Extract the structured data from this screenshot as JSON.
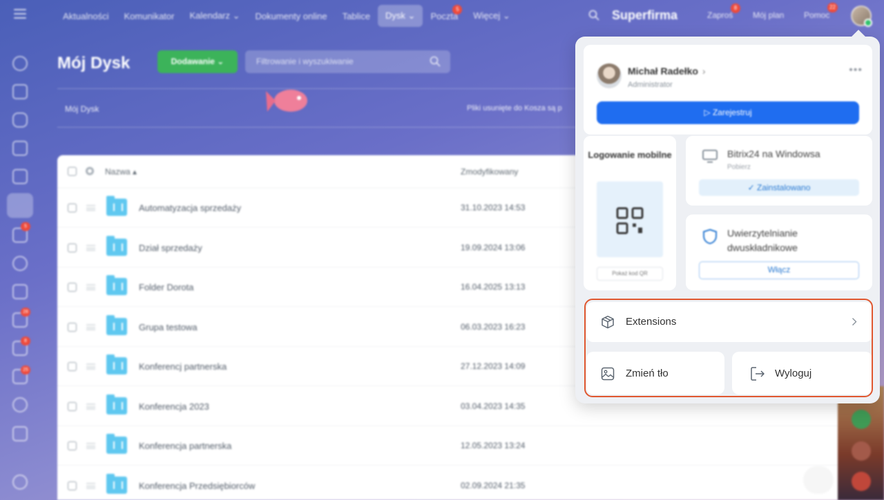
{
  "topbar": {
    "nav": [
      {
        "label": "Aktualności"
      },
      {
        "label": "Komunikator"
      },
      {
        "label": "Kalendarz ⌄"
      },
      {
        "label": "Dokumenty online"
      },
      {
        "label": "Tablice"
      },
      {
        "label": "Dysk ⌄"
      },
      {
        "label": "Poczta",
        "badge": "5"
      },
      {
        "label": "Więcej ⌄"
      }
    ],
    "brand": "Superfirma",
    "invite": "Zaproś",
    "invite_badge": "8",
    "my_plan": "Mój plan",
    "help": "Pomoc",
    "help_badge": "22"
  },
  "sidebar": {
    "badges": [
      "5",
      "28",
      "8",
      "25"
    ]
  },
  "page": {
    "title": "Mój Dysk",
    "add_button": "Dodawanie ⌄",
    "filter_placeholder": "Filtrowanie i wyszukiwanie",
    "breadcrumb": "Mój Dysk",
    "trash_info": "Pliki usunięte do Kosza są p"
  },
  "table": {
    "col_name": "Nazwa ▴",
    "col_modified": "Zmodyfikowany",
    "rows": [
      {
        "name": "Automatyzacja sprzedaży",
        "date": "31.10.2023 14:53"
      },
      {
        "name": "Dział sprzedaży",
        "date": "19.09.2024 13:06"
      },
      {
        "name": "Folder Dorota",
        "date": "16.04.2025 13:13"
      },
      {
        "name": "Grupa testowa",
        "date": "06.03.2023 16:23"
      },
      {
        "name": "Konferencj partnerska",
        "date": "27.12.2023 14:09"
      },
      {
        "name": "Konferencja 2023",
        "date": "03.04.2023 14:35"
      },
      {
        "name": "Konferencja partnerska",
        "date": "12.05.2023 13:24"
      },
      {
        "name": "Konferencja Przedsiębiorców",
        "date": "02.09.2024 21:35"
      }
    ]
  },
  "popup": {
    "user_name": "Michał Radełko",
    "user_role": "Administrator",
    "register_button": "▷ Zarejestruj",
    "mobile_login_title": "Logowanie mobilne",
    "show_qr": "Pokaż kod QR",
    "windows_app_title": "Bitrix24 na Windowsa",
    "windows_app_sub": "Pobierz",
    "installed": "✓ Zainstalowano",
    "tfa_title": "Uwierzytelnianie dwuskładnikowe",
    "enable_button": "Włącz",
    "extensions": "Extensions",
    "change_background": "Zmień tło",
    "logout": "Wyloguj"
  },
  "colors": {
    "accent": "#1f6df0",
    "add_button": "#3cb35a",
    "highlight": "#e0572f",
    "badge": "#ef4a3a"
  }
}
